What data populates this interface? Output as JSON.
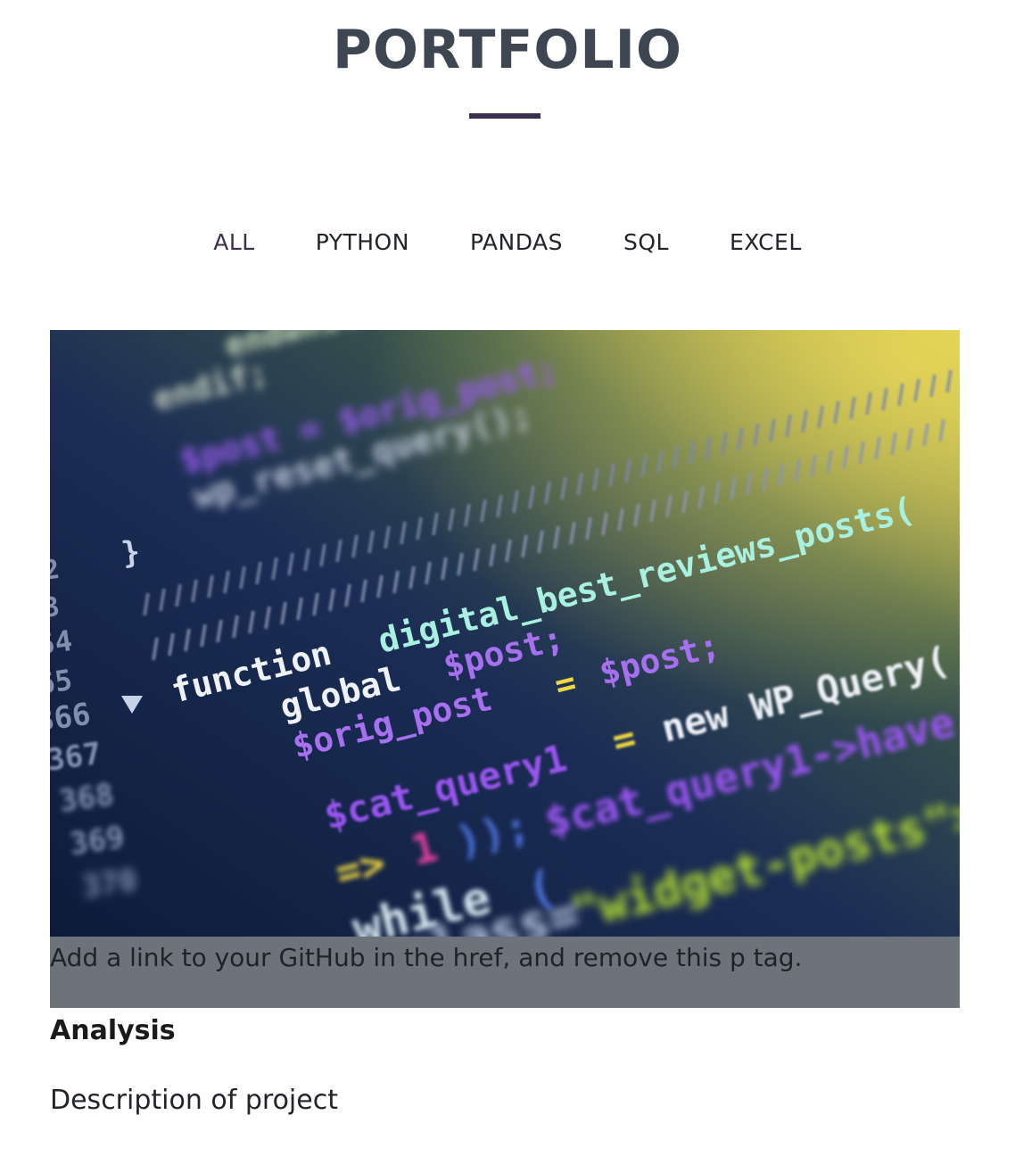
{
  "page": {
    "title": "PORTFOLIO"
  },
  "filters": {
    "items": [
      "ALL",
      "PYTHON",
      "PANDAS",
      "SQL",
      "EXCEL"
    ],
    "active": "ALL"
  },
  "project": {
    "caption": "Add a link to your GitHub in the href, and remove this p tag.",
    "title": "Analysis",
    "description": "Description of project"
  },
  "colors": {
    "title": "#3e4652",
    "accent": "#3a2f4f",
    "caption_bg": "#6c737b"
  }
}
